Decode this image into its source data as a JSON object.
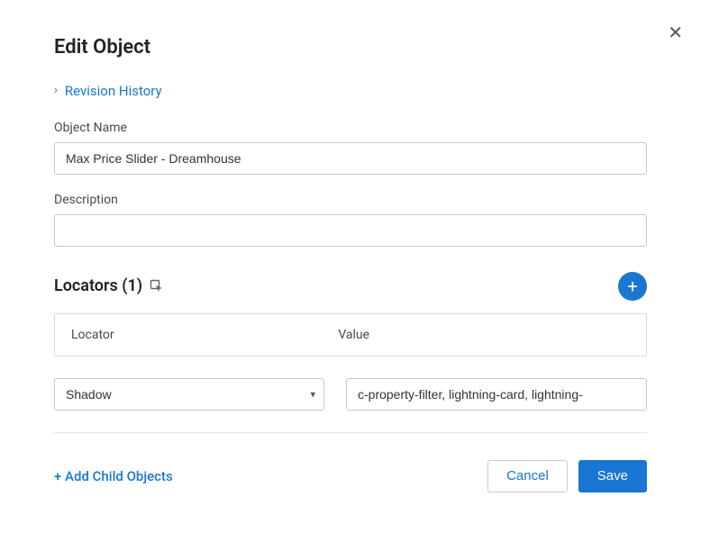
{
  "dialog": {
    "title": "Edit Object",
    "close_symbol": "✕",
    "revision_link": "Revision History"
  },
  "fields": {
    "object_name": {
      "label": "Object Name",
      "value": "Max Price Slider - Dreamhouse"
    },
    "description": {
      "label": "Description",
      "value": ""
    }
  },
  "locators": {
    "title": "Locators (1)",
    "columns": {
      "locator": "Locator",
      "value": "Value"
    },
    "rows": [
      {
        "type": "Shadow",
        "value": "c-property-filter, lightning-card, lightning-"
      }
    ],
    "plus_symbol": "+"
  },
  "footer": {
    "add_child": "+ Add Child Objects",
    "cancel": "Cancel",
    "save": "Save"
  }
}
